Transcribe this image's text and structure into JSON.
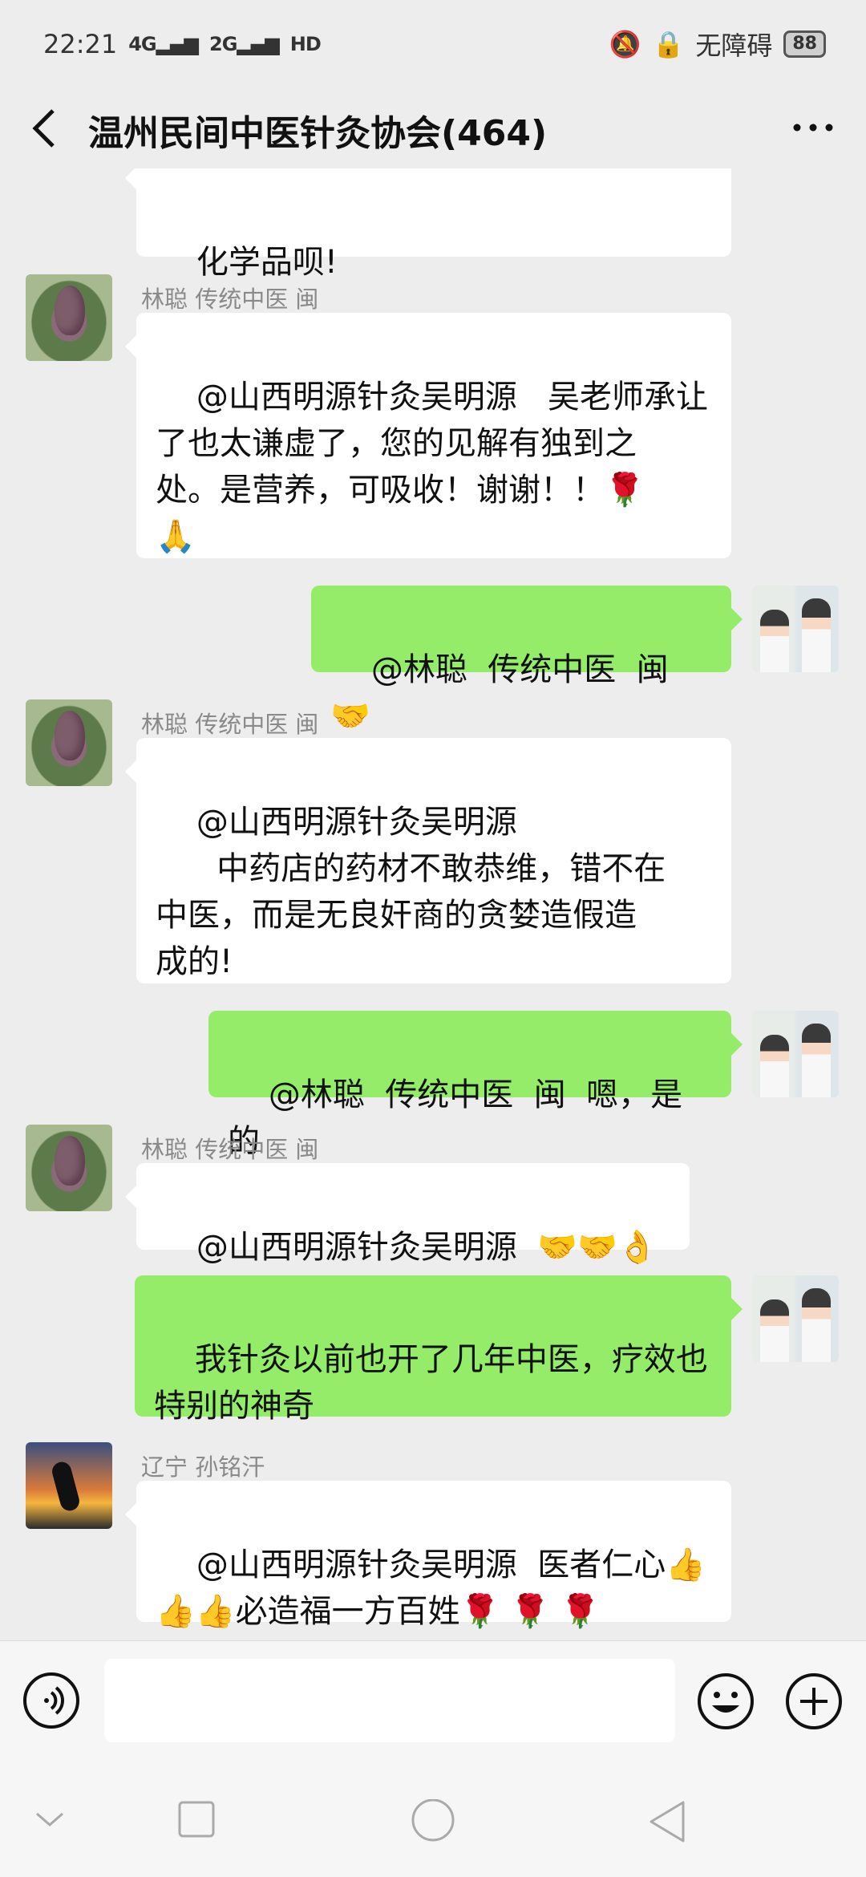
{
  "status_bar": {
    "time": "22:21",
    "signal_1": "4G",
    "signal_2": "2G",
    "hd_label": "HD",
    "accessibility_label": "无障碍",
    "battery": "88"
  },
  "header": {
    "title": "温州民间中医针灸协会(464)"
  },
  "messages": [
    {
      "side": "left",
      "partial": true,
      "text": "化学品呗!"
    },
    {
      "side": "left",
      "sender": "林聪  传统中医  闽",
      "avatar": "bud-avatar",
      "text": "@山西明源针灸吴明源   吴老师承让\n了也太谦虚了，您的见解有独到之\n处。是营养，可吸收！谢谢！！🌹\n🙏"
    },
    {
      "side": "right",
      "avatar": "doctor-avatar",
      "text": "@林聪  传统中医  闽  🤝"
    },
    {
      "side": "left",
      "sender": "林聪  传统中医  闽",
      "avatar": "bud-avatar",
      "text": "@山西明源针灸吴明源\n      中药店的药材不敢恭维，错不在\n中医，而是无良奸商的贪婪造假造\n成的!"
    },
    {
      "side": "right",
      "avatar": "doctor-avatar",
      "text": "@林聪  传统中医  闽  嗯，是的"
    },
    {
      "side": "left",
      "sender": "林聪  传统中医  闽",
      "avatar": "bud-avatar",
      "text": "@山西明源针灸吴明源  🤝🤝👌"
    },
    {
      "side": "right",
      "avatar": "doctor-avatar",
      "text": "我针灸以前也开了几年中医，疗效也\n特别的神奇"
    },
    {
      "side": "left",
      "sender": "辽宁  孙铭汗",
      "avatar": "runner-avatar",
      "text": "@山西明源针灸吴明源  医者仁心👍\n👍👍必造福一方百姓🌹 🌹 🌹"
    }
  ],
  "input_bar": {
    "voice_icon": "voice-icon",
    "emoji_icon": "emoji-icon",
    "plus_icon": "plus-icon",
    "placeholder": ""
  },
  "nav_bar": {
    "icons": [
      "down-chevron-icon",
      "square-icon",
      "circle-icon",
      "triangle-back-icon"
    ]
  },
  "colors": {
    "background": "#ededed",
    "bubble_left": "#ffffff",
    "bubble_right": "#95ec69",
    "sender_name": "#8a8a8a"
  }
}
